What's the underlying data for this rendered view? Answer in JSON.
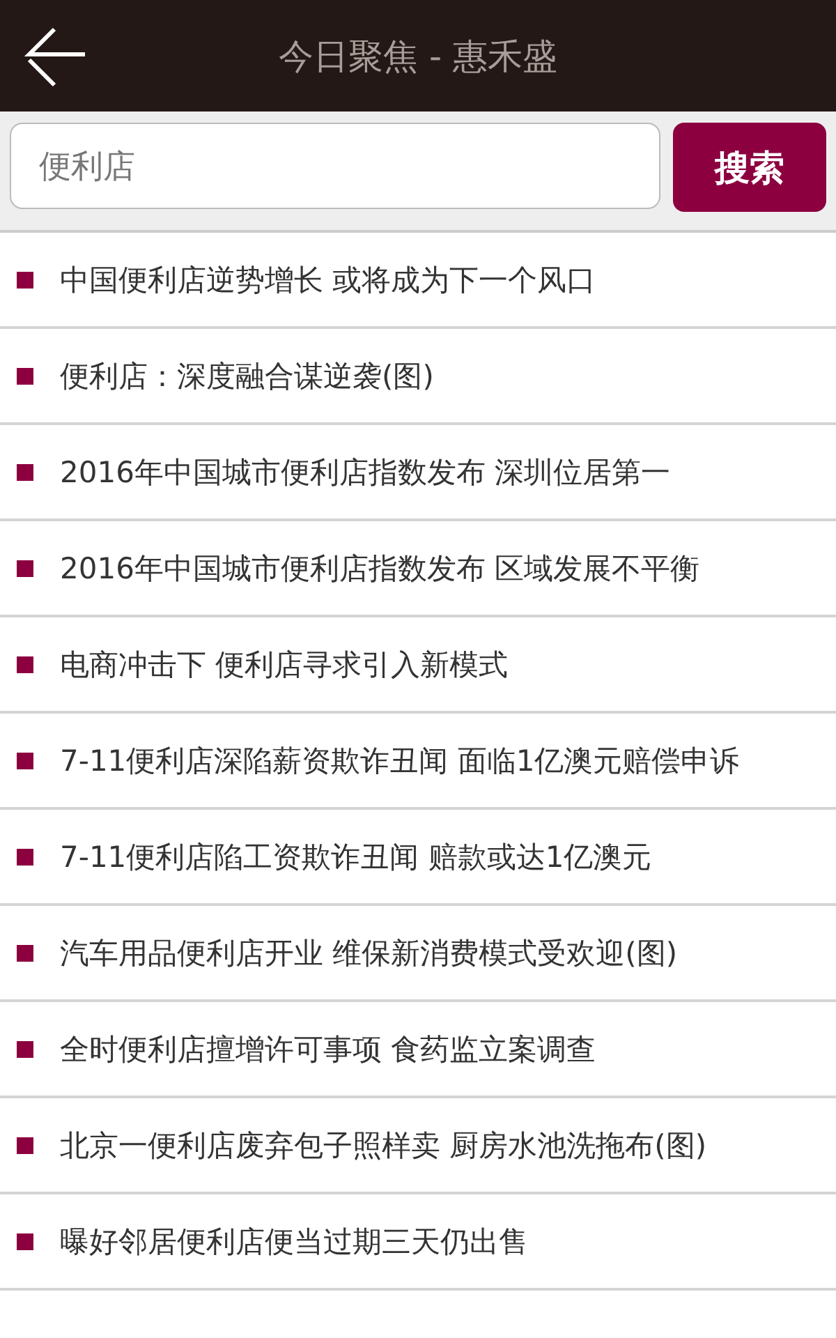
{
  "header": {
    "title": "今日聚焦 - 惠禾盛"
  },
  "search": {
    "value": "便利店",
    "button": "搜索"
  },
  "articles": [
    {
      "title": "中国便利店逆势增长 或将成为下一个风口"
    },
    {
      "title": "便利店：深度融合谋逆袭(图)"
    },
    {
      "title": "2016年中国城市便利店指数发布 深圳位居第一"
    },
    {
      "title": "2016年中国城市便利店指数发布 区域发展不平衡"
    },
    {
      "title": "电商冲击下 便利店寻求引入新模式"
    },
    {
      "title": "7-11便利店深陷薪资欺诈丑闻 面临1亿澳元赔偿申诉"
    },
    {
      "title": "7-11便利店陷工资欺诈丑闻 赔款或达1亿澳元"
    },
    {
      "title": "汽车用品便利店开业 维保新消费模式受欢迎(图)"
    },
    {
      "title": "全时便利店擅增许可事项 食药监立案调查"
    },
    {
      "title": "北京一便利店废弃包子照样卖 厨房水池洗拖布(图)"
    },
    {
      "title": "曝好邻居便利店便当过期三天仍出售"
    }
  ]
}
